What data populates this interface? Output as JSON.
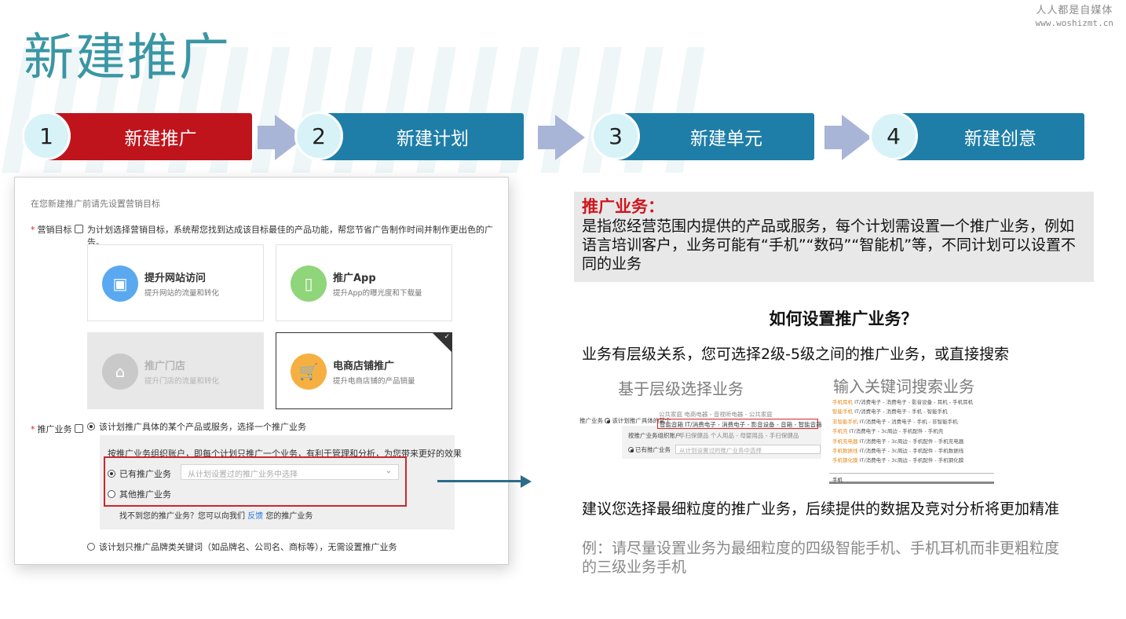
{
  "watermark": {
    "line1": "人人都是自媒体",
    "line2": "www.woshizmt.cn"
  },
  "page_title": "新建推广",
  "steps": [
    {
      "num": "1",
      "label": "新建推广",
      "color": "#c0141c"
    },
    {
      "num": "2",
      "label": "新建计划",
      "color": "#1e7ea8"
    },
    {
      "num": "3",
      "label": "新建单元",
      "color": "#1e7ea8"
    },
    {
      "num": "4",
      "label": "新建创意",
      "color": "#1e7ea8"
    }
  ],
  "screenshot": {
    "hint": "在您新建推广前请先设置营销目标",
    "goal_label": "营销目标",
    "goal_desc": "为计划选择营销目标，系统帮您找到达成该目标最佳的产品功能，帮您节省广告制作时间并制作更出色的广告。",
    "cards": [
      {
        "title": "提升网站访问",
        "sub": "提升网站的流量和转化",
        "icon": "monitor-icon",
        "color": "#5aa9f0"
      },
      {
        "title": "推广App",
        "sub": "提升App的曝光度和下载量",
        "icon": "phone-icon",
        "color": "#8fd57a"
      },
      {
        "title": "推广门店",
        "sub": "提升门店的流量和转化",
        "icon": "store-icon",
        "color": "#c9c9c9"
      },
      {
        "title": "电商店铺推广",
        "sub": "提升电商店铺的产品销量",
        "icon": "cart-icon",
        "color": "#f5b041"
      }
    ],
    "biz_label": "推广业务",
    "biz_option1": "该计划推广具体的某个产品或服务，选择一个推广业务",
    "panel_desc": "按推广业务组织账户，即每个计划只推广一个业务，有利于管理和分析，为您带来更好的效果",
    "existing": "已有推广业务",
    "select_placeholder": "从计划设置过的推广业务中选择",
    "other": "其他推广业务",
    "notfound_pre": "找不到您的推广业务？您可以向我们",
    "feedback": "反馈",
    "notfound_post": "您的推广业务",
    "biz_option2": "该计划只推广品牌类关键词（如品牌名、公司名、商标等），无需设置推广业务"
  },
  "info": {
    "title": "推广业务：",
    "body": "是指您经营范围内提供的产品或服务，每个计划需设置一个推广业务，例如语言培训客户，业务可能有“手机”“数码”“智能机”等，不同计划可以设置不同的业务"
  },
  "how_title": "如何设置推广业务？",
  "levels_text": "业务有层级关系，您可选择2级-5级之间的推广业务，或直接搜索",
  "col1_title": "基于层级选择业务",
  "col2_title": "输入关键词搜索业务",
  "mini1": {
    "row0": "公共家庭  电商电器 - 音视听电器 - 公共家庭",
    "label": "推广业务",
    "option": "该计划推广具体的某个",
    "row1": "智能音箱  IT/消费电子 - 消费电子 - 影音设备 - 音箱 - 智能音箱",
    "row2a": "按推广业务组织账户",
    "row2b": "手扫保健品  个人用品 - 母婴用品 - 手扫保健品",
    "existing": "已有推广业务",
    "select": "从计划设置过的推广业务中选择"
  },
  "mini2": {
    "rows": [
      {
        "k": "手机耳机",
        "v": "IT/消费电子 - 消费电子 - 影音设备 - 耳机 - 手机耳机"
      },
      {
        "k": "智能手机",
        "v": "IT/消费电子 - 消费电子 - 手机 - 智能手机"
      },
      {
        "k": "非智能手机",
        "v": "IT/消费电子 - 消费电子 - 手机 - 非智能手机"
      },
      {
        "k": "手机壳",
        "v": "IT/消费电子 - 3c周边 - 手机配件 - 手机壳"
      },
      {
        "k": "手机充电器",
        "v": "IT/消费电子 - 3c周边 - 手机配件 - 手机充电器"
      },
      {
        "k": "手机数据线",
        "v": "IT/消费电子 - 3c周边 - 手机配件 - 手机数据线"
      },
      {
        "k": "手机钢化膜",
        "v": "IT/消费电子 - 3c周边 - 手机配件 - 手机钢化膜"
      }
    ],
    "input": "手机"
  },
  "suggest_text": "建议您选择最细粒度的推广业务，后续提供的数据及竞对分析将更加精准",
  "example_text": "例：请尽量设置业务为最细粒度的四级智能手机、手机耳机而非更粗粒度的三级业务手机"
}
